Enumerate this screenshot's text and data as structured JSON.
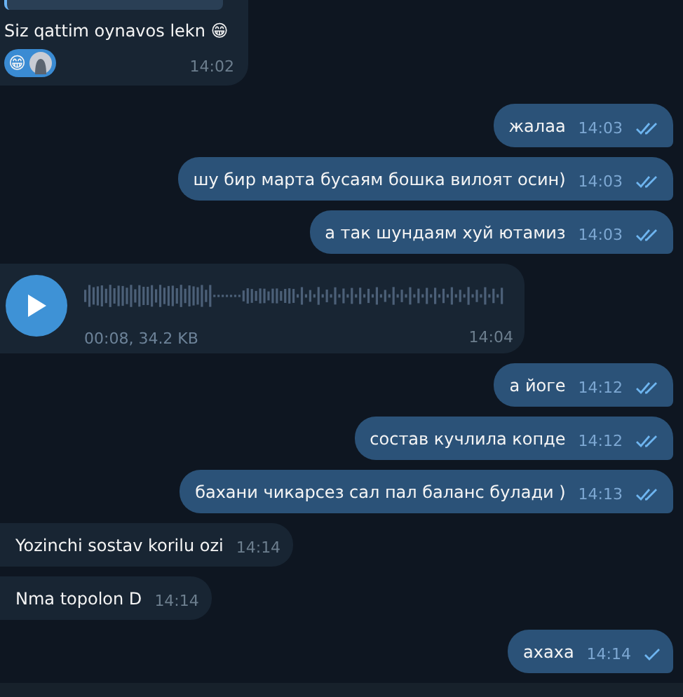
{
  "messages": [
    {
      "kind": "text",
      "outgoing": false,
      "has_reply_preview": true,
      "text": "Siz qattim oynavos lekn 😁",
      "reaction": {
        "emoji": "😁"
      },
      "time": "14:02"
    },
    {
      "kind": "text",
      "outgoing": true,
      "text": "жалаа",
      "time": "14:03",
      "read": true
    },
    {
      "kind": "text",
      "outgoing": true,
      "text": "шу бир марта бусаям бошка вилоят осин)",
      "time": "14:03",
      "read": true
    },
    {
      "kind": "text",
      "outgoing": true,
      "text": "а так шундаям хуй ютамиз",
      "time": "14:03",
      "read": true
    },
    {
      "kind": "voice",
      "outgoing": false,
      "meta": "00:08, 34.2 KB",
      "time": "14:04"
    },
    {
      "kind": "text",
      "outgoing": true,
      "text": "а йоге",
      "time": "14:12",
      "read": true
    },
    {
      "kind": "text",
      "outgoing": true,
      "text": "состав кучлила копде",
      "time": "14:12",
      "read": true
    },
    {
      "kind": "text",
      "outgoing": true,
      "text": "бахани чикарсез сал пал баланс булади )",
      "time": "14:13",
      "read": true
    },
    {
      "kind": "text",
      "outgoing": false,
      "text": "Yozinchi sostav korilu ozi",
      "time": "14:14"
    },
    {
      "kind": "text",
      "outgoing": false,
      "text": "Nma topolon D",
      "time": "14:14"
    },
    {
      "kind": "text",
      "outgoing": true,
      "text": "ахаха",
      "time": "14:14",
      "read": false
    }
  ]
}
